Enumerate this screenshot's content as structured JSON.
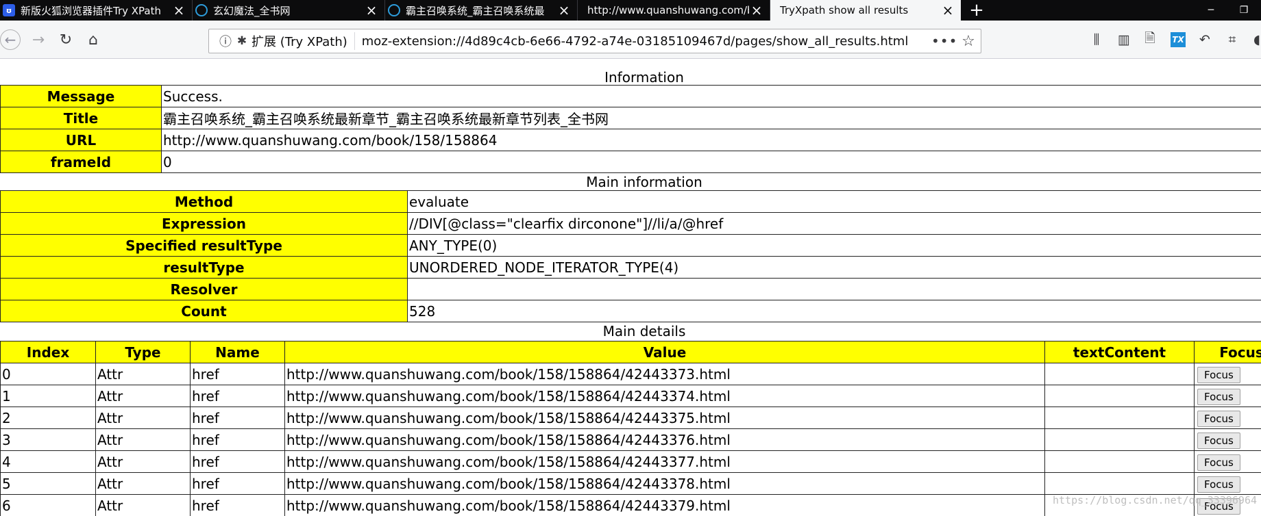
{
  "tabs": [
    {
      "title": "新版火狐浏览器插件Try XPath",
      "favicon": "baidu-paw-icon",
      "active": false
    },
    {
      "title": "玄幻魔法_全书网",
      "favicon": "globe-icon",
      "active": false
    },
    {
      "title": "霸主召唤系统_霸主召唤系统最",
      "favicon": "globe-icon",
      "active": false
    },
    {
      "title": "http://www.quanshuwang.com/b",
      "favicon": "",
      "active": false
    },
    {
      "title": "TryXpath show all results",
      "favicon": "",
      "active": true
    }
  ],
  "navbar": {
    "identity_label": "扩展 (Try XPath)",
    "url": "moz-extension://4d89c4cb-6e66-4792-a74e-03185109467d/pages/show_all_results.html"
  },
  "information": {
    "caption": "Information",
    "rows": [
      {
        "key": "Message",
        "value": "Success."
      },
      {
        "key": "Title",
        "value": "霸主召唤系统_霸主召唤系统最新章节_霸主召唤系统最新章节列表_全书网"
      },
      {
        "key": "URL",
        "value": "http://www.quanshuwang.com/book/158/158864"
      },
      {
        "key": "frameId",
        "value": "0"
      }
    ]
  },
  "main_information": {
    "caption": "Main information",
    "rows": [
      {
        "key": "Method",
        "value": "evaluate"
      },
      {
        "key": "Expression",
        "value": "//DIV[@class=\"clearfix dirconone\"]//li/a/@href"
      },
      {
        "key": "Specified resultType",
        "value": "ANY_TYPE(0)"
      },
      {
        "key": "resultType",
        "value": "UNORDERED_NODE_ITERATOR_TYPE(4)"
      },
      {
        "key": "Resolver",
        "value": ""
      },
      {
        "key": "Count",
        "value": "528"
      }
    ]
  },
  "main_details": {
    "caption": "Main details",
    "headers": [
      "Index",
      "Type",
      "Name",
      "Value",
      "textContent",
      "Focus"
    ],
    "focus_label": "Focus",
    "rows": [
      {
        "index": "0",
        "type": "Attr",
        "name": "href",
        "value": "http://www.quanshuwang.com/book/158/158864/42443373.html",
        "text": ""
      },
      {
        "index": "1",
        "type": "Attr",
        "name": "href",
        "value": "http://www.quanshuwang.com/book/158/158864/42443374.html",
        "text": ""
      },
      {
        "index": "2",
        "type": "Attr",
        "name": "href",
        "value": "http://www.quanshuwang.com/book/158/158864/42443375.html",
        "text": ""
      },
      {
        "index": "3",
        "type": "Attr",
        "name": "href",
        "value": "http://www.quanshuwang.com/book/158/158864/42443376.html",
        "text": ""
      },
      {
        "index": "4",
        "type": "Attr",
        "name": "href",
        "value": "http://www.quanshuwang.com/book/158/158864/42443377.html",
        "text": ""
      },
      {
        "index": "5",
        "type": "Attr",
        "name": "href",
        "value": "http://www.quanshuwang.com/book/158/158864/42443378.html",
        "text": ""
      },
      {
        "index": "6",
        "type": "Attr",
        "name": "href",
        "value": "http://www.quanshuwang.com/book/158/158864/42443379.html",
        "text": ""
      }
    ]
  },
  "watermark": "https://blog.csdn.net/qq_33396964",
  "colors": {
    "key_background": "#ffff00",
    "tabstrip": "#0c0c0d",
    "toolbar": "#f5f6f7"
  }
}
